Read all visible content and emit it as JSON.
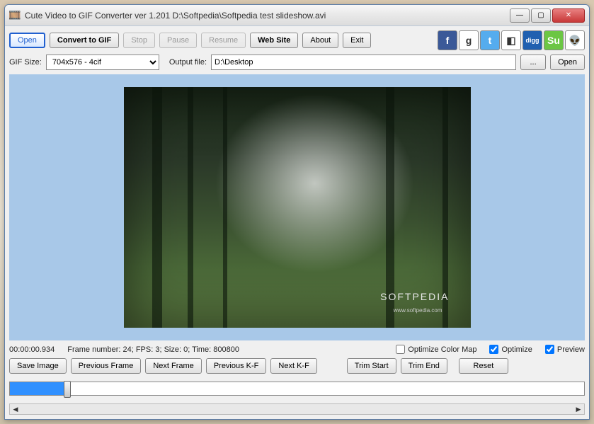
{
  "window": {
    "title": "Cute Video to GIF Converter ver 1.201  D:\\Softpedia\\Softpedia test slideshow.avi"
  },
  "toolbar": {
    "open": "Open",
    "convert": "Convert to GIF",
    "stop": "Stop",
    "pause": "Pause",
    "resume": "Resume",
    "website": "Web Site",
    "about": "About",
    "exit": "Exit"
  },
  "social": [
    {
      "name": "facebook",
      "bg": "#3b5998",
      "label": "f"
    },
    {
      "name": "google",
      "bg": "#ffffff",
      "label": "g"
    },
    {
      "name": "twitter",
      "bg": "#55acee",
      "label": "t"
    },
    {
      "name": "delicious",
      "bg": "#ffffff",
      "label": "◧"
    },
    {
      "name": "digg",
      "bg": "#2060b0",
      "label": "digg"
    },
    {
      "name": "stumbleupon",
      "bg": "#6cc644",
      "label": "Su"
    },
    {
      "name": "reddit",
      "bg": "#ffffff",
      "label": "👽"
    }
  ],
  "options": {
    "gifsize_label": "GIF Size:",
    "gifsize_value": "704x576 - 4cif",
    "output_label": "Output file:",
    "output_value": "D:\\Desktop",
    "browse": "...",
    "open2": "Open"
  },
  "preview": {
    "watermark": "SOFTPEDIA",
    "watermark_sub": "www.softpedia.com"
  },
  "status": {
    "time": "00:00:00.934",
    "info": "Frame number: 24; FPS: 3; Size: 0; Time: 800800",
    "optimize_colormap": "Optimize Color Map",
    "optimize": "Optimize",
    "preview": "Preview",
    "optimize_colormap_checked": false,
    "optimize_checked": true,
    "preview_checked": true
  },
  "bottom_buttons": {
    "save_image": "Save Image",
    "prev_frame": "Previous Frame",
    "next_frame": "Next Frame",
    "prev_kf": "Previous K-F",
    "next_kf": "Next K-F",
    "trim_start": "Trim Start",
    "trim_end": "Trim End",
    "reset": "Reset"
  },
  "slider": {
    "percent": 10
  }
}
